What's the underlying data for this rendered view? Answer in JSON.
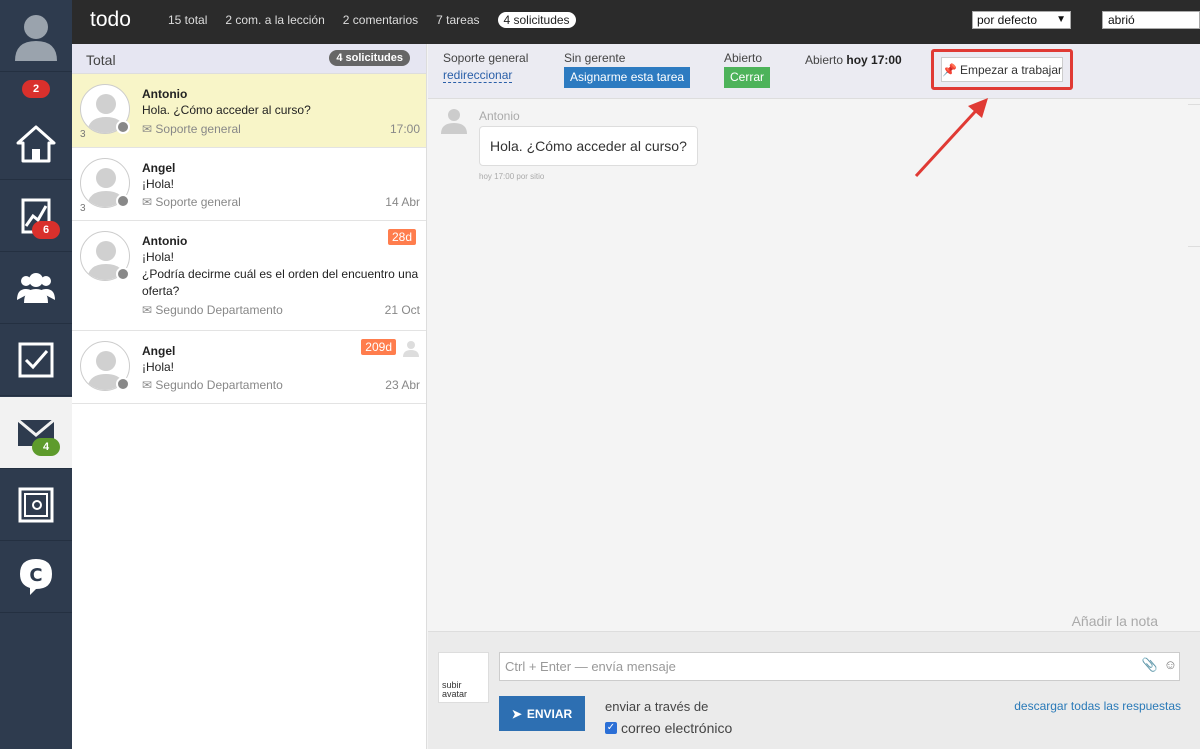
{
  "sidebar": {
    "badges": {
      "profile": "2",
      "stats": "6",
      "mail": "4"
    }
  },
  "topbar": {
    "title": "todo",
    "links": [
      "15 total",
      "2 com. a la lección",
      "2 comentarios",
      "7 tareas"
    ],
    "active_link": "4 solicitudes",
    "sort_select": "por defecto",
    "filter_value": "abrió"
  },
  "list": {
    "header_label": "Total",
    "header_count": "4 solicitudes",
    "requests": [
      {
        "num": "3",
        "name": "Antonio",
        "text": "Hola. ¿Cómo acceder al curso?",
        "dept": "Soporte general",
        "time": "17:00",
        "age": ""
      },
      {
        "num": "3",
        "name": "Angel",
        "text": "¡Hola!",
        "dept": "Soporte general",
        "time": "14 Abr",
        "age": ""
      },
      {
        "num": "",
        "name": "Antonio",
        "text": "¡Hola!\n¿Podría decirme cuál es el orden del encuentro una oferta?",
        "dept": "Segundo Departamento",
        "time": "21 Oct",
        "age": "28d"
      },
      {
        "num": "",
        "name": "Angel",
        "text": "¡Hola!",
        "dept": "Segundo Departamento",
        "time": "23 Abr",
        "age": "209d"
      }
    ]
  },
  "infobar": {
    "dept_label": "Soporte general",
    "redirect_link": "redireccionar",
    "manager_label": "Sin gerente",
    "assign_button": "Asignarme esta tarea",
    "status_label": "Abierto",
    "close_button": "Cerrar",
    "opened_prefix": "Abierto",
    "opened_time": "hoy 17:00",
    "start_button": "Empezar a trabajar"
  },
  "conversation": {
    "author": "Antonio",
    "message": "Hola. ¿Cómo acceder al curso?",
    "meta": "hoy 17:00 por sitio",
    "add_note": "Añadir la nota"
  },
  "composer": {
    "upload_avatar": "subir avatar",
    "placeholder": "Ctrl + Enter — envía mensaje",
    "send_button": "ENVIAR",
    "send_via": "enviar a través de",
    "email_option": "correo electrónico",
    "download_link": "descargar todas las respuestas"
  },
  "colors": {
    "sidebar_bg": "#2e3b4e",
    "topbar_bg": "#2b2b2b",
    "selected_row": "#f8f5c8",
    "age_badge": "#ff7d4d",
    "highlight": "#e03a34",
    "primary_button": "#2d7bc1",
    "close_button": "#4db35a"
  }
}
